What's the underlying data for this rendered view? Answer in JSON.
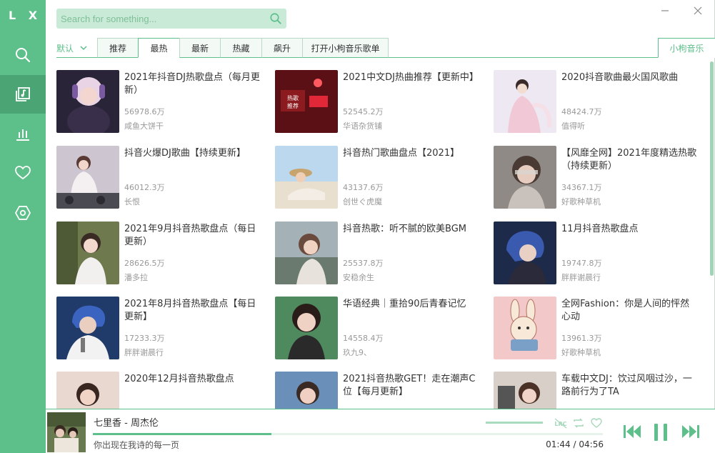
{
  "app": {
    "logo": "L X"
  },
  "search": {
    "placeholder": "Search for something..."
  },
  "sort": {
    "label": "默认"
  },
  "tabs": [
    {
      "label": "推荐"
    },
    {
      "label": "最热"
    },
    {
      "label": "最新"
    },
    {
      "label": "热藏"
    },
    {
      "label": "飙升"
    },
    {
      "label": "打开小枸音乐歌单"
    }
  ],
  "source": {
    "label": "小枸音乐"
  },
  "playlists": [
    {
      "title": "2021年抖音DJ热歌盘点（每月更新）",
      "count": "56978.6万",
      "author": "咸鱼大饼干"
    },
    {
      "title": "2021中文DJ热曲推荐【更新中】",
      "count": "52545.2万",
      "author": "华语杂货铺"
    },
    {
      "title": "2020抖音歌曲最火国风歌曲",
      "count": "48424.7万",
      "author": "值得听"
    },
    {
      "title": "抖音火爆DJ歌曲【持续更新】",
      "count": "46012.3万",
      "author": "长恨"
    },
    {
      "title": "抖音热门歌曲盘点【2021】",
      "count": "43137.6万",
      "author": "创世ぐ虎魔"
    },
    {
      "title": "【风靡全网】2021年度精选热歌（持续更新）",
      "count": "34367.1万",
      "author": "好歌种草机"
    },
    {
      "title": "2021年9月抖音热歌盘点（每日更新）",
      "count": "28626.5万",
      "author": "潘多拉"
    },
    {
      "title": "抖音热歌：听不腻的欧美BGM",
      "count": "25537.8万",
      "author": "安稳余生"
    },
    {
      "title": "11月抖音热歌盘点",
      "count": "19747.8万",
      "author": "胖胖谢晨行"
    },
    {
      "title": "2021年8月抖音热歌盘点【每日更新】",
      "count": "17233.3万",
      "author": "胖胖谢晨行"
    },
    {
      "title": "华语经典｜重拾90后青春记忆",
      "count": "14558.4万",
      "author": "玖九9、"
    },
    {
      "title": "全网Fashion：你是人间的怦然心动",
      "count": "13961.3万",
      "author": "好歌种草机"
    },
    {
      "title": "2020年12月抖音热歌盘点",
      "count": "",
      "author": ""
    },
    {
      "title": "2021抖音热歌GET！走在潮声C位【每月更新】",
      "count": "",
      "author": ""
    },
    {
      "title": "车载中文DJ：饮过风咽过沙，一路前行为了TA",
      "count": "",
      "author": ""
    }
  ],
  "player": {
    "title": "七里香 - 周杰伦",
    "lyric": "你出现在我诗的每一页",
    "current_time": "01:44",
    "separator": "/",
    "total_time": "04:56",
    "progress_fraction": 0.35,
    "lrc_label": "LRC"
  },
  "colors": {
    "accent": "#5dbf8a",
    "sidebar_active": "#4aa474",
    "search_bg": "#c9ead7"
  }
}
